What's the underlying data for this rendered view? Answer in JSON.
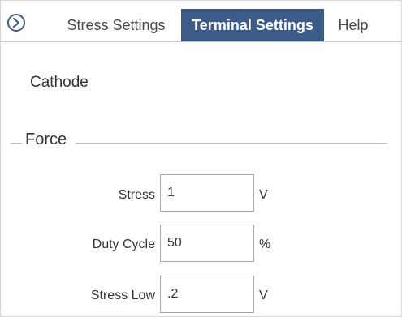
{
  "tabs": {
    "stress_label": "Stress Settings",
    "terminal_label": "Terminal Settings",
    "help_label": "Help"
  },
  "section": {
    "title": "Cathode"
  },
  "force": {
    "legend": "Force",
    "rows": [
      {
        "label": "Stress",
        "value": "1",
        "unit": "V"
      },
      {
        "label": "Duty Cycle",
        "value": "50",
        "unit": "%"
      },
      {
        "label": "Stress Low",
        "value": ".2",
        "unit": "V"
      }
    ]
  },
  "icons": {
    "nav": "chevron-right-circle-icon"
  },
  "colors": {
    "active_tab": "#3d5b88",
    "icon": "#3f5f86"
  }
}
